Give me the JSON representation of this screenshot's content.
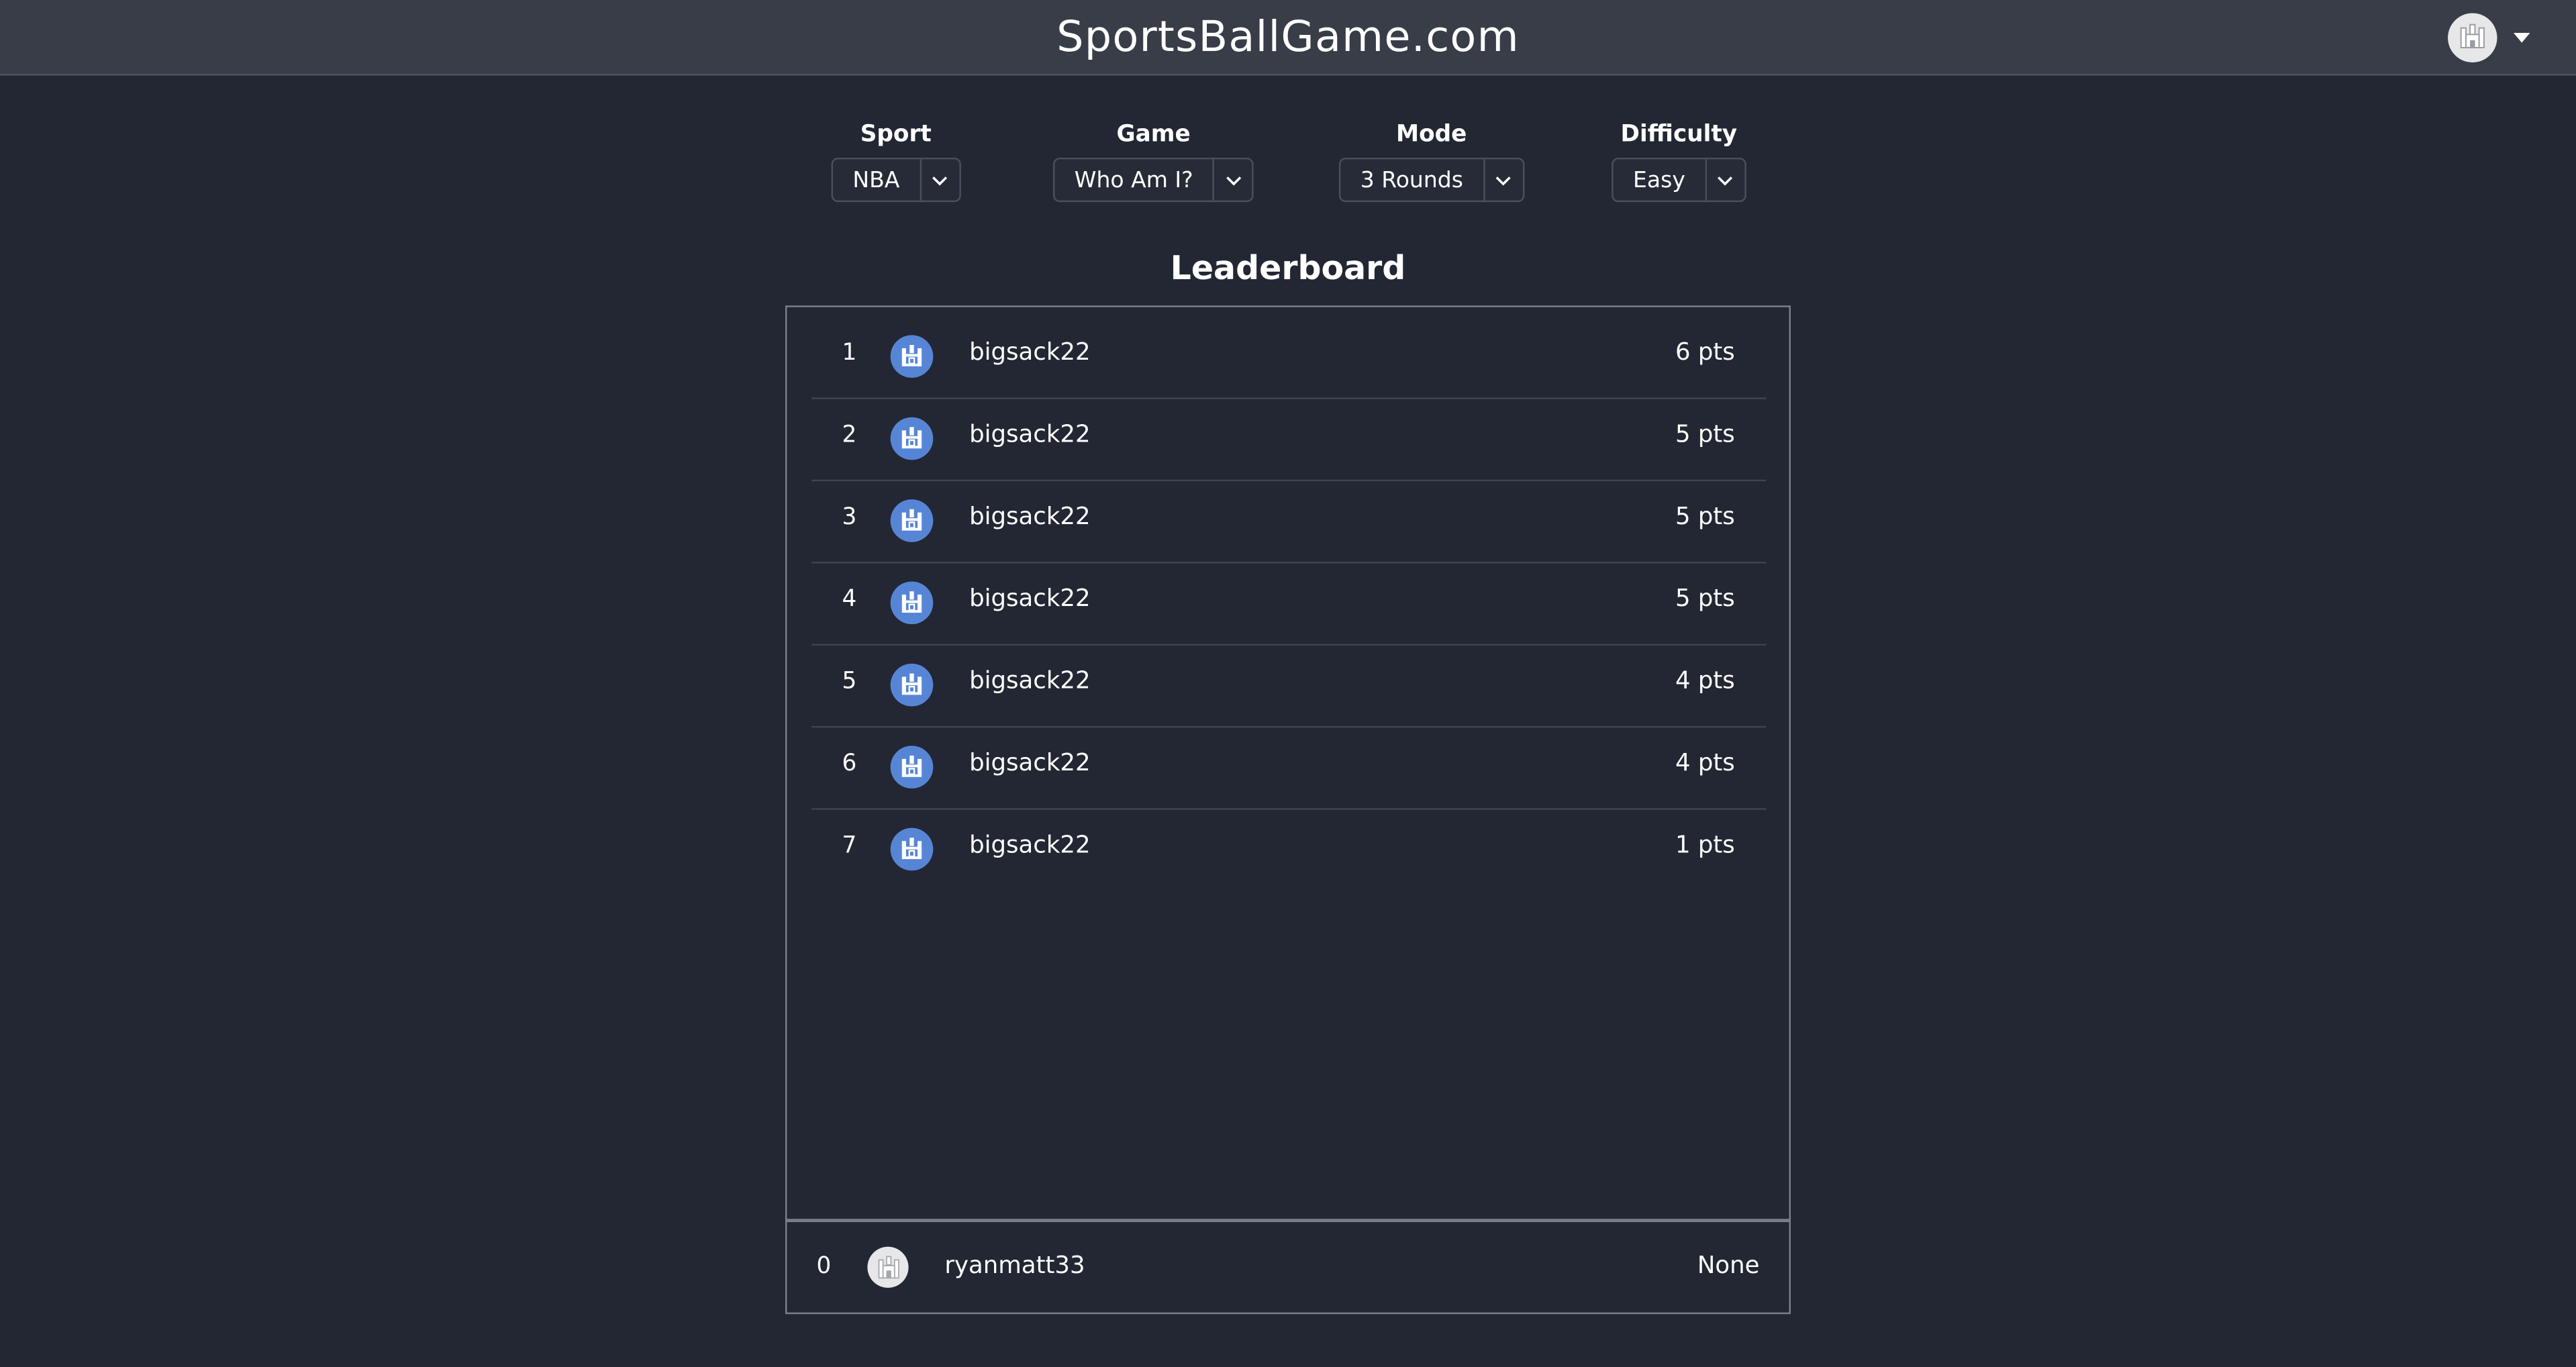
{
  "header": {
    "brand": "SportsBallGame.com",
    "avatar_icon": "castle-icon",
    "menu_icon": "caret-down-icon"
  },
  "filters": {
    "sport": {
      "label": "Sport",
      "value": "NBA"
    },
    "game": {
      "label": "Game",
      "value": "Who Am I?"
    },
    "mode": {
      "label": "Mode",
      "value": "3 Rounds"
    },
    "difficulty": {
      "label": "Difficulty",
      "value": "Easy"
    }
  },
  "leaderboard": {
    "title": "Leaderboard",
    "rows": [
      {
        "rank": "1",
        "username": "bigsack22",
        "points": "6 pts"
      },
      {
        "rank": "2",
        "username": "bigsack22",
        "points": "5 pts"
      },
      {
        "rank": "3",
        "username": "bigsack22",
        "points": "5 pts"
      },
      {
        "rank": "4",
        "username": "bigsack22",
        "points": "5 pts"
      },
      {
        "rank": "5",
        "username": "bigsack22",
        "points": "4 pts"
      },
      {
        "rank": "6",
        "username": "bigsack22",
        "points": "4 pts"
      },
      {
        "rank": "7",
        "username": "bigsack22",
        "points": "1 pts"
      }
    ]
  },
  "current_user": {
    "rank": "0",
    "username": "ryanmatt33",
    "points": "None"
  },
  "colors": {
    "background": "#222733",
    "header": "#383d48",
    "avatar_blue": "#5785d6",
    "avatar_grey": "#e7e7e9"
  }
}
